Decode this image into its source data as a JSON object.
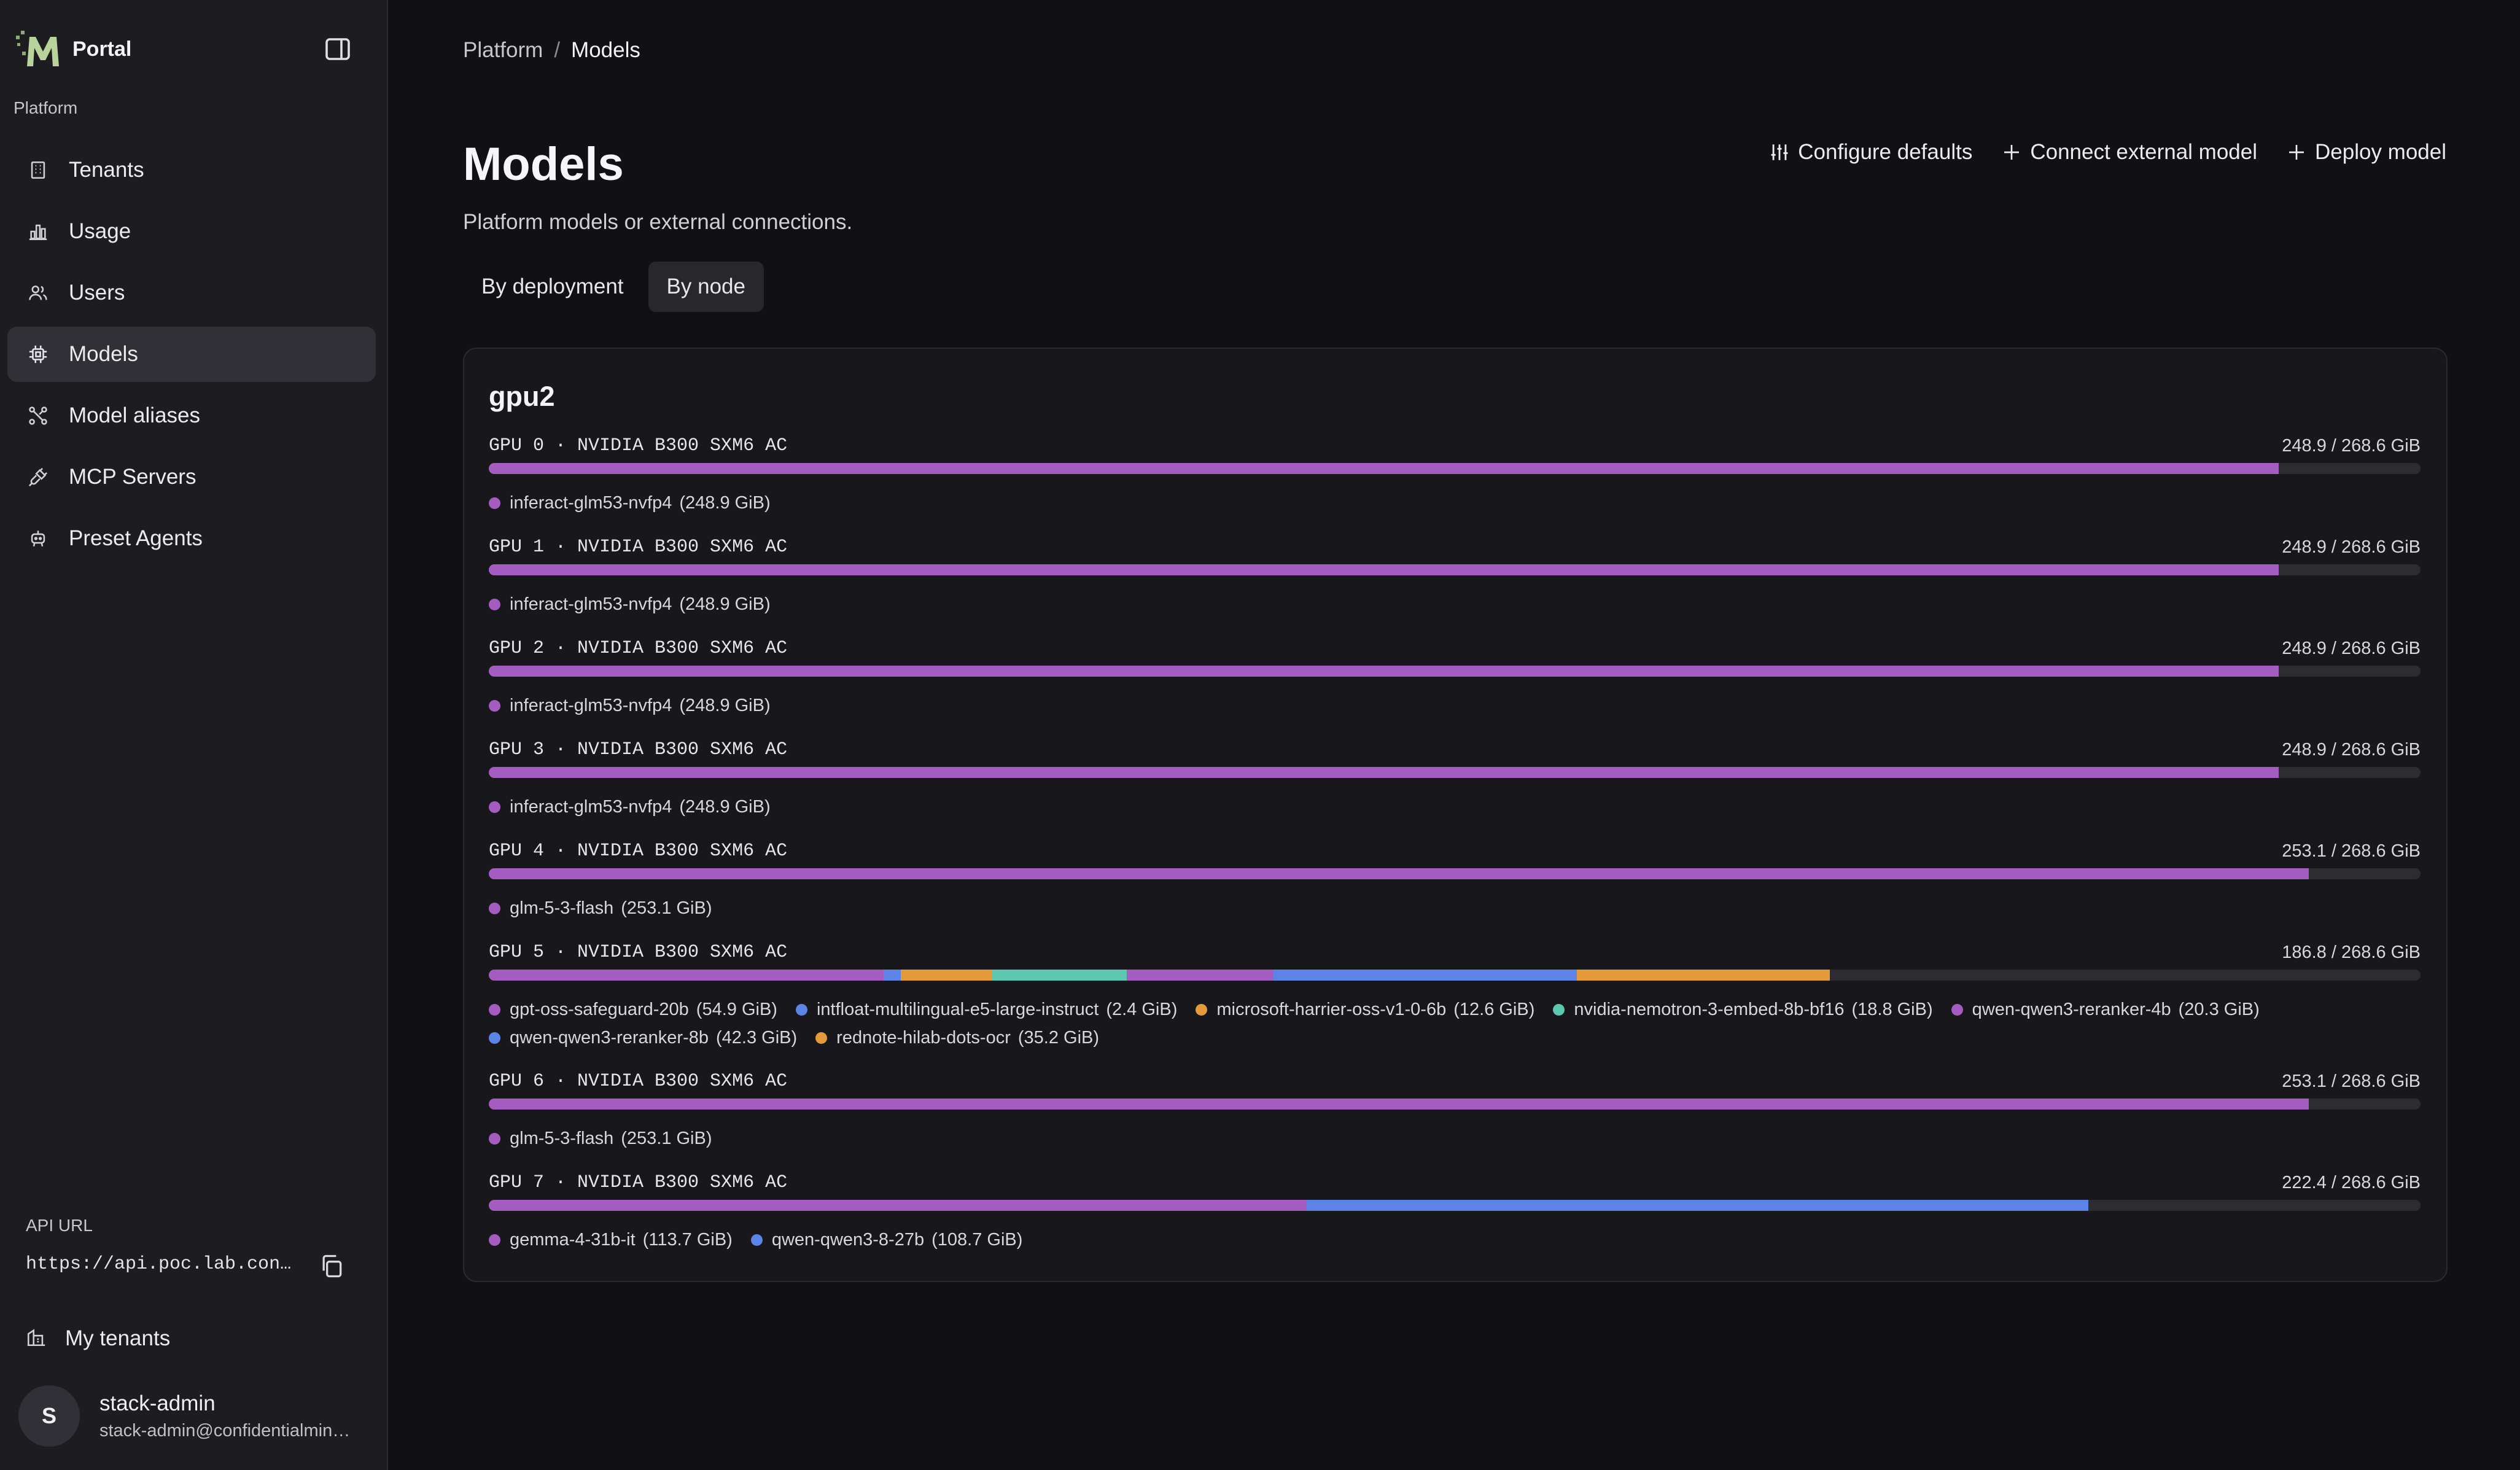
{
  "app": {
    "name": "Portal"
  },
  "colors": {
    "purple": "#a45cc0",
    "blue": "#5b84e6",
    "orange": "#e59a3a",
    "teal": "#5ec7b0",
    "track": "#2c2c31"
  },
  "sidebar": {
    "section_label": "Platform",
    "items": [
      {
        "label": "Tenants",
        "icon": "building-icon"
      },
      {
        "label": "Usage",
        "icon": "bar-chart-icon"
      },
      {
        "label": "Users",
        "icon": "users-icon"
      },
      {
        "label": "Models",
        "icon": "chip-icon",
        "active": true
      },
      {
        "label": "Model aliases",
        "icon": "alias-icon"
      },
      {
        "label": "MCP Servers",
        "icon": "plug-icon"
      },
      {
        "label": "Preset Agents",
        "icon": "agent-icon"
      }
    ],
    "api_label": "API URL",
    "api_url": "https://api.poc.lab.con…",
    "my_tenants": "My tenants",
    "user": {
      "initial": "S",
      "name": "stack-admin",
      "email": "stack-admin@confidentialmin…"
    }
  },
  "breadcrumb": {
    "parent": "Platform",
    "sep": "/",
    "current": "Models"
  },
  "header": {
    "title": "Models",
    "subtitle": "Platform models or external connections.",
    "actions": {
      "configure": "Configure defaults",
      "connect": "Connect external model",
      "deploy": "Deploy model"
    }
  },
  "tabs": [
    {
      "label": "By deployment"
    },
    {
      "label": "By node",
      "active": true
    }
  ],
  "node": {
    "name": "gpu2",
    "total_gib": 268.6,
    "gpus": [
      {
        "name": "GPU 0 · NVIDIA B300 SXM6 AC",
        "usage": "248.9 / 268.6 GiB",
        "models": [
          {
            "name": "inferact-glm53-nvfp4",
            "size": "(248.9 GiB)",
            "gib": 248.9,
            "color": "purple"
          }
        ]
      },
      {
        "name": "GPU 1 · NVIDIA B300 SXM6 AC",
        "usage": "248.9 / 268.6 GiB",
        "models": [
          {
            "name": "inferact-glm53-nvfp4",
            "size": "(248.9 GiB)",
            "gib": 248.9,
            "color": "purple"
          }
        ]
      },
      {
        "name": "GPU 2 · NVIDIA B300 SXM6 AC",
        "usage": "248.9 / 268.6 GiB",
        "models": [
          {
            "name": "inferact-glm53-nvfp4",
            "size": "(248.9 GiB)",
            "gib": 248.9,
            "color": "purple"
          }
        ]
      },
      {
        "name": "GPU 3 · NVIDIA B300 SXM6 AC",
        "usage": "248.9 / 268.6 GiB",
        "models": [
          {
            "name": "inferact-glm53-nvfp4",
            "size": "(248.9 GiB)",
            "gib": 248.9,
            "color": "purple"
          }
        ]
      },
      {
        "name": "GPU 4 · NVIDIA B300 SXM6 AC",
        "usage": "253.1 / 268.6 GiB",
        "models": [
          {
            "name": "glm-5-3-flash",
            "size": "(253.1 GiB)",
            "gib": 253.1,
            "color": "purple"
          }
        ]
      },
      {
        "name": "GPU 5 · NVIDIA B300 SXM6 AC",
        "usage": "186.8 / 268.6 GiB",
        "models": [
          {
            "name": "gpt-oss-safeguard-20b",
            "size": "(54.9 GiB)",
            "gib": 54.9,
            "color": "purple"
          },
          {
            "name": "intfloat-multilingual-e5-large-instruct",
            "size": "(2.4 GiB)",
            "gib": 2.4,
            "color": "blue"
          },
          {
            "name": "microsoft-harrier-oss-v1-0-6b",
            "size": "(12.6 GiB)",
            "gib": 12.6,
            "color": "orange"
          },
          {
            "name": "nvidia-nemotron-3-embed-8b-bf16",
            "size": "(18.8 GiB)",
            "gib": 18.8,
            "color": "teal"
          },
          {
            "name": "qwen-qwen3-reranker-4b",
            "size": "(20.3 GiB)",
            "gib": 20.3,
            "color": "purple"
          },
          {
            "name": "qwen-qwen3-reranker-8b",
            "size": "(42.3 GiB)",
            "gib": 42.3,
            "color": "blue"
          },
          {
            "name": "rednote-hilab-dots-ocr",
            "size": "(35.2 GiB)",
            "gib": 35.2,
            "color": "orange"
          }
        ]
      },
      {
        "name": "GPU 6 · NVIDIA B300 SXM6 AC",
        "usage": "253.1 / 268.6 GiB",
        "models": [
          {
            "name": "glm-5-3-flash",
            "size": "(253.1 GiB)",
            "gib": 253.1,
            "color": "purple"
          }
        ]
      },
      {
        "name": "GPU 7 · NVIDIA B300 SXM6 AC",
        "usage": "222.4 / 268.6 GiB",
        "models": [
          {
            "name": "gemma-4-31b-it",
            "size": "(113.7 GiB)",
            "gib": 113.7,
            "color": "purple"
          },
          {
            "name": "qwen-qwen3-8-27b",
            "size": "(108.7 GiB)",
            "gib": 108.7,
            "color": "blue"
          }
        ]
      }
    ]
  }
}
